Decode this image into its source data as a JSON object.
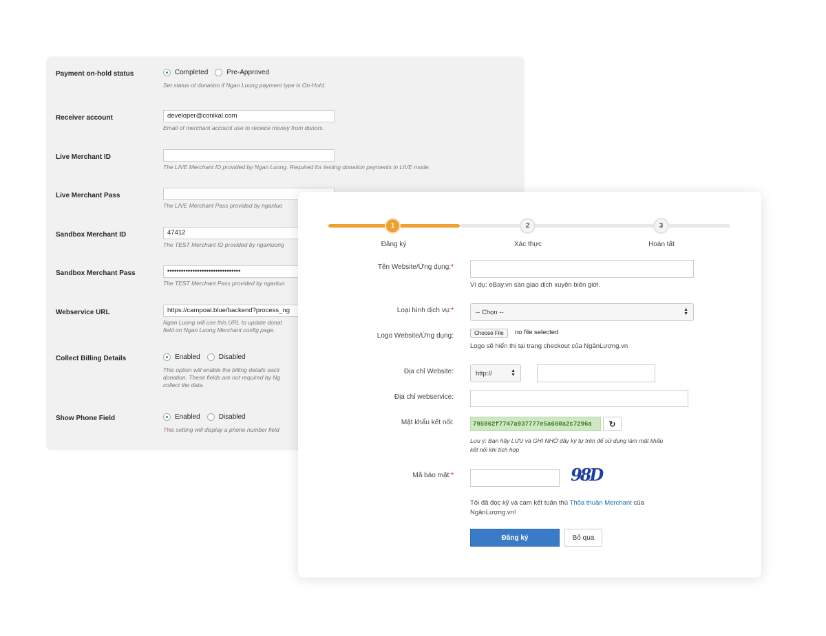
{
  "settings": {
    "rows": [
      {
        "label": "Payment on-hold status",
        "type": "radio",
        "options": [
          "Completed",
          "Pre-Approved"
        ],
        "selected": 0,
        "desc": [
          "Set status of donation if Ngan Luong payment type is On-Hold."
        ]
      },
      {
        "label": "Receiver account",
        "type": "text",
        "value": "developer@conikal.com",
        "desc": [
          "Email of merchant account use to receice money from donors."
        ]
      },
      {
        "label": "Live Merchant ID",
        "type": "text",
        "value": "",
        "desc": [
          "The LIVE Merchant ID provided by Ngan Luong. Required for testing donation payments in LIVE mode."
        ]
      },
      {
        "label": "Live Merchant Pass",
        "type": "text",
        "value": "",
        "desc": [
          "The LIVE Merchant Pass provided by nganluo"
        ]
      },
      {
        "label": "Sandbox Merchant ID",
        "type": "text",
        "value": "47412",
        "desc": [
          "The TEST Merchant ID provided by nganluong"
        ]
      },
      {
        "label": "Sandbox Merchant Pass",
        "type": "text",
        "value": "••••••••••••••••••••••••••••••••",
        "desc": [
          "The TEST Merchant Pass provided by nganluo"
        ]
      },
      {
        "label": "Webservice URL",
        "type": "text",
        "value": "https://campoal.blue/backend?process_ng",
        "desc": [
          "Ngan Luong will use this URL to update donat",
          "field on Ngan Luong Merchant config page."
        ]
      },
      {
        "label": "Collect Billing Details",
        "type": "radio",
        "options": [
          "Enabled",
          "Disabled"
        ],
        "selected": 0,
        "desc": [
          "This option will enable the billing details secti",
          "donation. These fields are not required by Ng",
          "collect the data."
        ]
      },
      {
        "label": "Show Phone Field",
        "type": "radio",
        "options": [
          "Enabled",
          "Disabled"
        ],
        "selected": 0,
        "desc": [
          "This setting will display a phone number field"
        ]
      }
    ]
  },
  "register": {
    "steps": [
      {
        "number": "1",
        "label": "Đăng ký"
      },
      {
        "number": "2",
        "label": "Xác thực"
      },
      {
        "number": "3",
        "label": "Hoàn tất"
      }
    ],
    "active_step": 1,
    "accent_color": "#f0a033",
    "website_name": {
      "label": "Tên Website/Ứng dụng:",
      "required": "*",
      "value": "",
      "hint": "Ví dụ: eBay.vn sàn giao dịch xuyên biên giới."
    },
    "service_type": {
      "label": "Loại hình dịch vụ:",
      "required": "*",
      "selected": "-- Chọn --"
    },
    "logo": {
      "label": "Logo Website/Ứng dụng:",
      "button": "Choose File",
      "status": "no file selected",
      "hint": "Logo sẽ hiển thị tại trang checkout của NgânLượng.vn"
    },
    "website_address": {
      "label": "Địa chỉ Website:",
      "protocol": "http://",
      "value": ""
    },
    "webservice_address": {
      "label": "Địa chỉ webservice:",
      "value": ""
    },
    "connect_password": {
      "label": "Mật khẩu kết nối:",
      "value": "795962f7747a937777e5a680a2c7296a",
      "refresh_icon": "refresh-icon",
      "note_line1": "Lưu ý: Bạn hãy LƯU và GHI NHỚ dãy ký tự trên để sử dụng làm mật khẩu",
      "note_line2": "kết nối khi tích hợp"
    },
    "security_code": {
      "label": "Mã bảo mật:",
      "required": "*",
      "value": "",
      "captcha": "98D"
    },
    "terms": {
      "prefix": "Tôi đã đọc kỹ và cam kết tuân thủ",
      "link": "Thỏa thuận Merchant",
      "suffix": "của NgânLượng.vn!"
    },
    "submit_label": "Đăng ký",
    "cancel_label": "Bỏ qua"
  }
}
